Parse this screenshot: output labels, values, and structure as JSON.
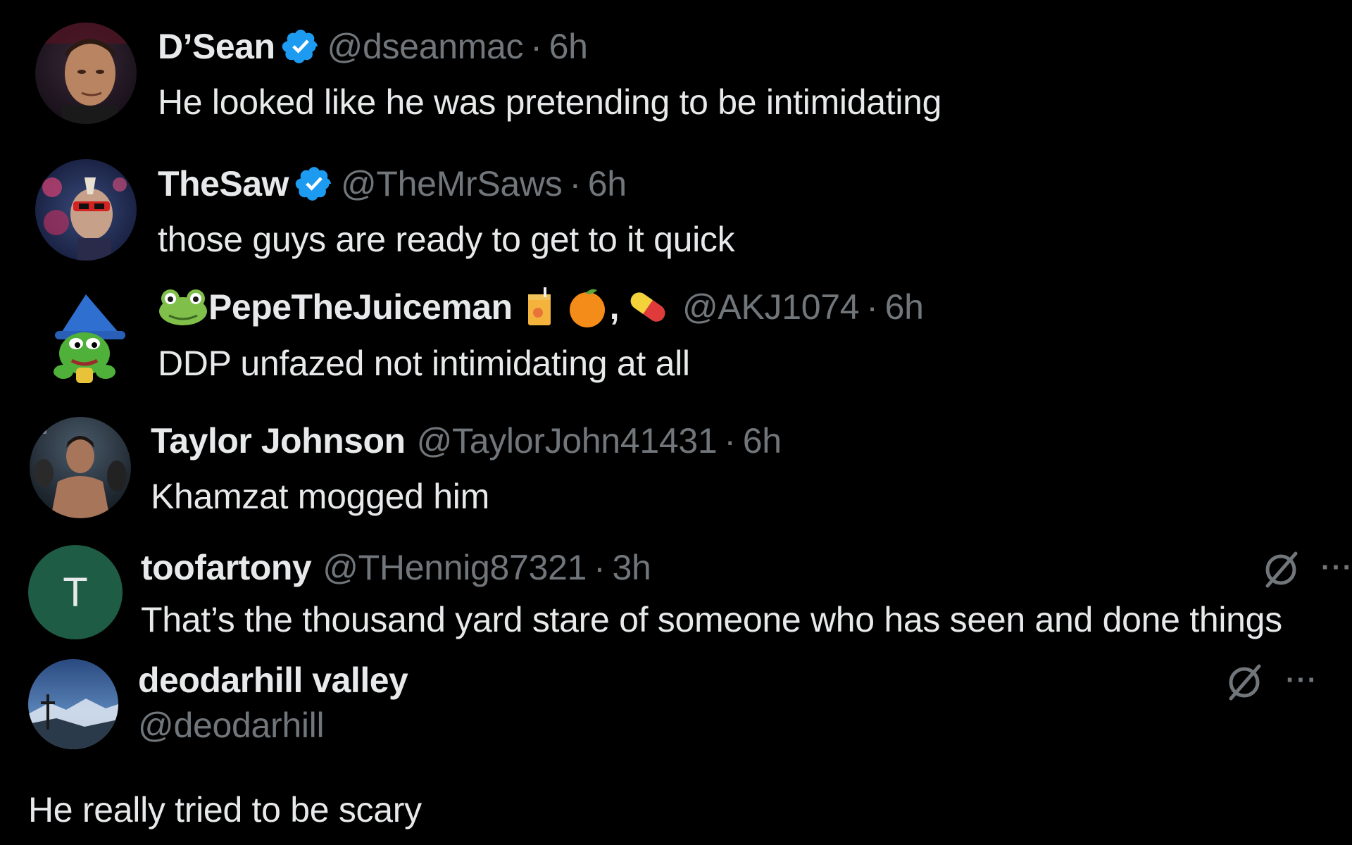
{
  "replies": [
    {
      "display_name": "D’Sean",
      "verified": true,
      "handle": "@dseanmac",
      "separator": "·",
      "time": "6h",
      "text": "He looked like he was pretending to be intimidating",
      "avatar_icon": "photo-avatar-icon"
    },
    {
      "display_name": "TheSaw",
      "verified": true,
      "handle": "@TheMrSaws",
      "separator": "·",
      "time": "6h",
      "text": "those guys are ready to get to it quick",
      "avatar_icon": "photo-avatar-icon"
    },
    {
      "display_name": "PepeTheJuiceman",
      "name_suffix": ",",
      "name_emojis": [
        "frog-emoji",
        "juice-box-emoji",
        "orange-emoji",
        "pill-emoji"
      ],
      "verified": false,
      "handle": "@AKJ1074",
      "separator": "·",
      "time": "6h",
      "text": "DDP unfazed not intimidating at all",
      "avatar_icon": "pepe-wizard-avatar-icon"
    },
    {
      "display_name": "Taylor Johnson",
      "verified": false,
      "handle": "@TaylorJohn41431",
      "separator": "·",
      "time": "6h",
      "text": "Khamzat mogged him",
      "avatar_icon": "photo-avatar-icon"
    },
    {
      "display_name": "toofartony",
      "verified": false,
      "handle": "@THennig87321",
      "separator": "·",
      "time": "3h",
      "text": "That’s the thousand yard stare of someone who has seen and done things",
      "avatar_letter": "T",
      "avatar_color": "#1f5c45",
      "actions": [
        "grok-icon",
        "more-icon"
      ]
    },
    {
      "display_name": "deodarhill valley",
      "verified": false,
      "handle": "@deodarhill",
      "text": "He really tried to be scary",
      "avatar_icon": "landscape-avatar-icon",
      "actions": [
        "grok-icon",
        "more-icon"
      ]
    }
  ],
  "colors": {
    "background": "#000000",
    "primary_text": "#e7e9ea",
    "secondary_text": "#71767b",
    "verified_blue": "#1d9bf0"
  },
  "more_glyph": "···"
}
